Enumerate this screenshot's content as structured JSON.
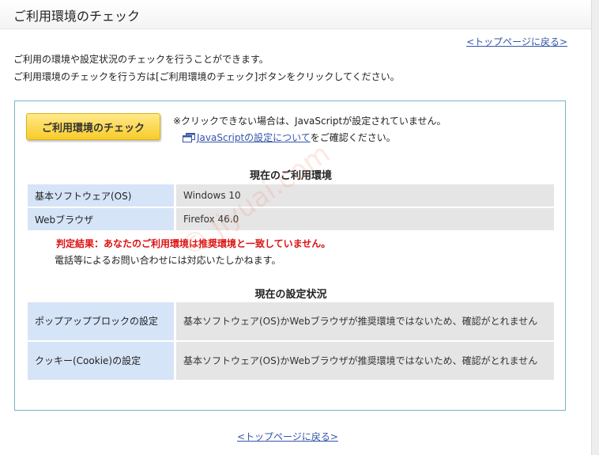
{
  "page": {
    "title": "ご利用環境のチェック",
    "top_link": "<トップページに戻る>",
    "intro_line_1": "ご利用の環境や設定状況のチェックを行うことができます。",
    "intro_line_2": "ご利用環境のチェックを行う方は[ご利用環境のチェック]ボタンをクリックしてください。"
  },
  "check": {
    "button_label": "ご利用環境のチェック",
    "note_1": "※クリックできない場合は、JavaScriptが設定されていません。",
    "js_link": "JavaScriptの設定について",
    "note_2_suffix": "をご確認ください。"
  },
  "environment": {
    "title": "現在のご利用環境",
    "rows": [
      {
        "label": "基本ソフトウェア(OS)",
        "value": "Windows 10"
      },
      {
        "label": "Webブラウザ",
        "value": "Firefox 46.0"
      }
    ],
    "verdict": "判定結果：あなたのご利用環境は推奨環境と一致していません。",
    "verdict_note": "電話等によるお問い合わせには対応いたしかねます。"
  },
  "settings": {
    "title": "現在の設定状況",
    "rows": [
      {
        "label": "ポップアップブロックの設定",
        "value": "基本ソフトウェア(OS)かWebブラウザが推奨環境ではないため、確認がとれません"
      },
      {
        "label": "クッキー(Cookie)の設定",
        "value": "基本ソフトウェア(OS)かWebブラウザが推奨環境ではないため、確認がとれません"
      }
    ]
  },
  "watermark": "© Jiyuai.com",
  "colors": {
    "verdict": "#dd1111",
    "link": "#3355aa",
    "button": "#f8cc2a",
    "label_cell": "#d6e4f8",
    "value_cell": "#e5e5e5",
    "box_border": "#7ab4c4"
  },
  "icons": {
    "js_link_icon": "window-icon"
  }
}
